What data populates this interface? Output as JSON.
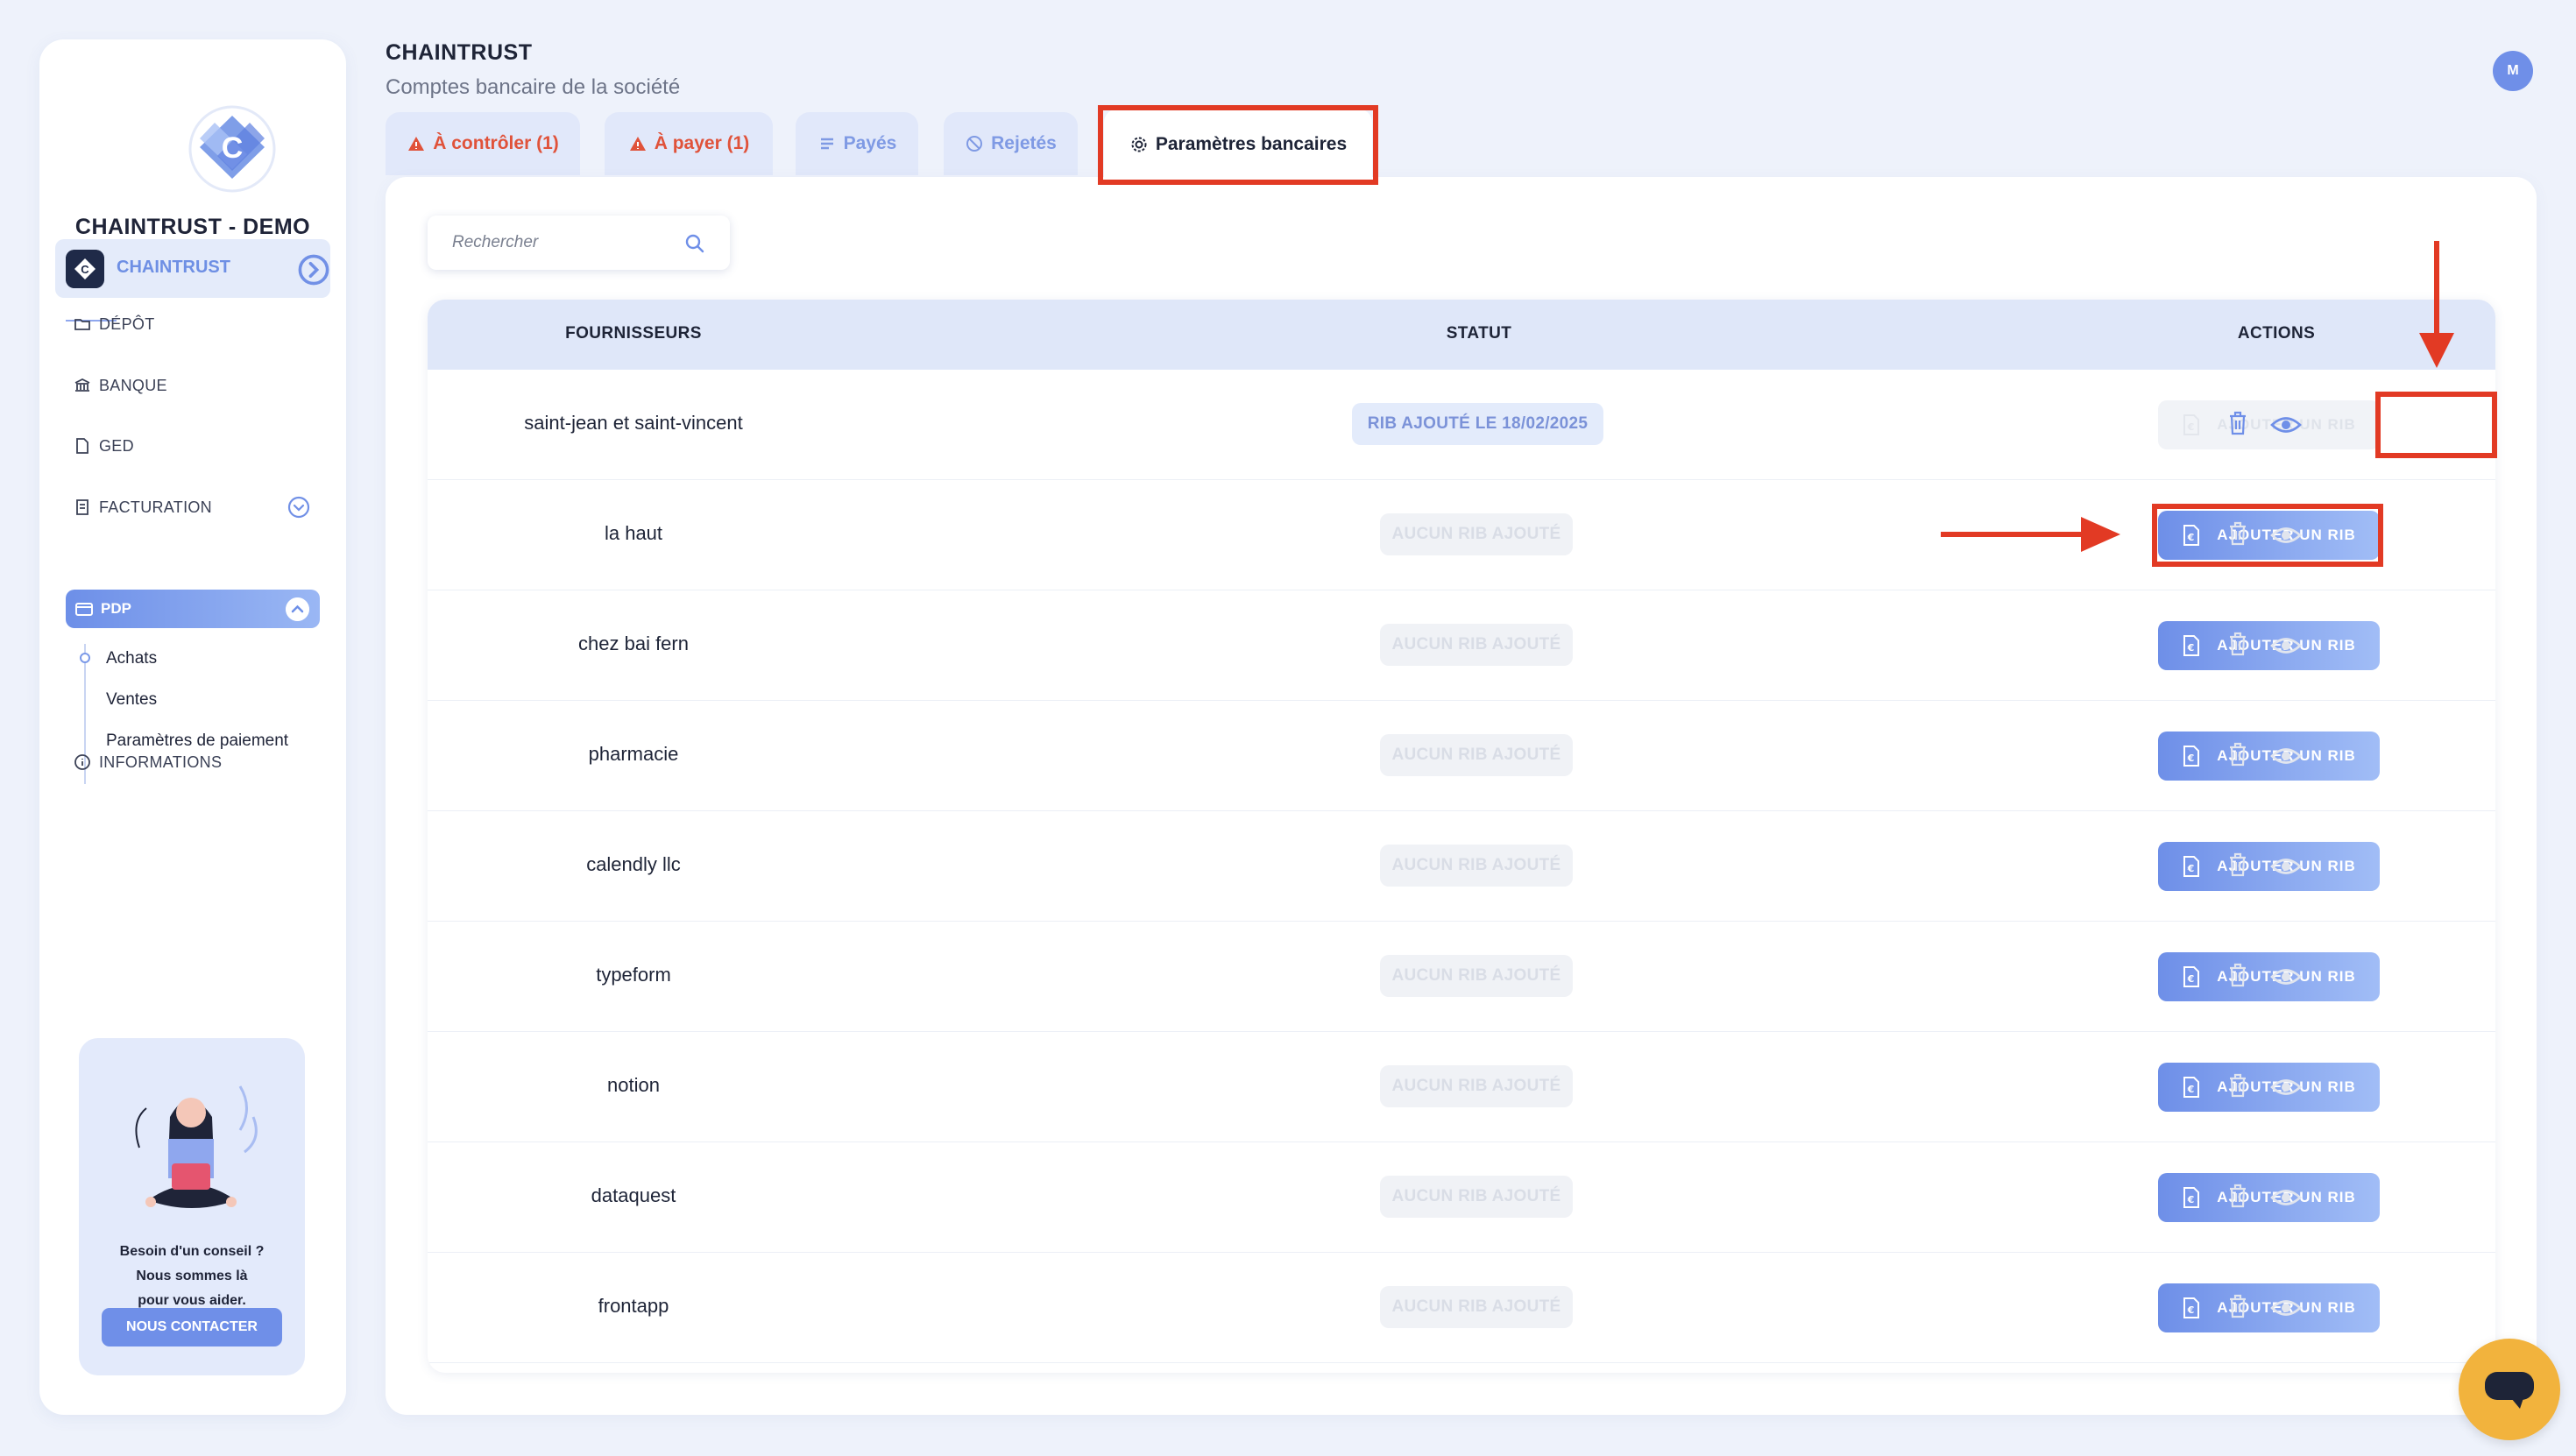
{
  "sidebar": {
    "org_name": "CHAINTRUST - DEMO",
    "company": "CHAINTRUST",
    "nav": [
      "DÉPÔT",
      "BANQUE",
      "GED",
      "FACTURATION"
    ],
    "pdp_label": "PDP",
    "sub_items": [
      "Achats",
      "Ventes",
      "Paramètres de paiement"
    ],
    "info_label": "INFORMATIONS",
    "help_text": "Besoin d'un conseil ?\nNous sommes là\npour vous aider.",
    "help_button": "NOUS CONTACTER"
  },
  "header": {
    "title": "CHAINTRUST",
    "subtitle": "Comptes bancaire de la société",
    "avatar": "M"
  },
  "tabs": [
    {
      "label": "À contrôler (1)",
      "icon": "warning-icon",
      "color": "#e0523a"
    },
    {
      "label": "À payer (1)",
      "icon": "warning-icon",
      "color": "#e0523a"
    },
    {
      "label": "Payés",
      "icon": "list-icon",
      "color": "#7f9ae4"
    },
    {
      "label": "Rejetés",
      "icon": "block-icon",
      "color": "#7f9ae4"
    },
    {
      "label": "Paramètres bancaires",
      "icon": "gear-icon",
      "active": true
    }
  ],
  "search": {
    "placeholder": "Rechercher"
  },
  "table": {
    "headers": [
      "FOURNISSEURS",
      "STATUT",
      "ACTIONS"
    ],
    "add_label": "AJOUTER UN RIB",
    "rows": [
      {
        "supplier": "saint-jean et saint-vincent",
        "status": "RIB AJOUTÉ LE 18/02/2025",
        "has_rib": true
      },
      {
        "supplier": "la haut",
        "status": "AUCUN RIB AJOUTÉ",
        "has_rib": false
      },
      {
        "supplier": "chez bai fern",
        "status": "AUCUN RIB AJOUTÉ",
        "has_rib": false
      },
      {
        "supplier": "pharmacie",
        "status": "AUCUN RIB AJOUTÉ",
        "has_rib": false
      },
      {
        "supplier": "calendly llc",
        "status": "AUCUN RIB AJOUTÉ",
        "has_rib": false
      },
      {
        "supplier": "typeform",
        "status": "AUCUN RIB AJOUTÉ",
        "has_rib": false
      },
      {
        "supplier": "notion",
        "status": "AUCUN RIB AJOUTÉ",
        "has_rib": false
      },
      {
        "supplier": "dataquest",
        "status": "AUCUN RIB AJOUTÉ",
        "has_rib": false
      },
      {
        "supplier": "frontapp",
        "status": "AUCUN RIB AJOUTÉ",
        "has_rib": false
      }
    ]
  },
  "colors": {
    "accent": "#6f8fe8",
    "highlight": "#e23a24",
    "chat": "#f2b33d"
  }
}
